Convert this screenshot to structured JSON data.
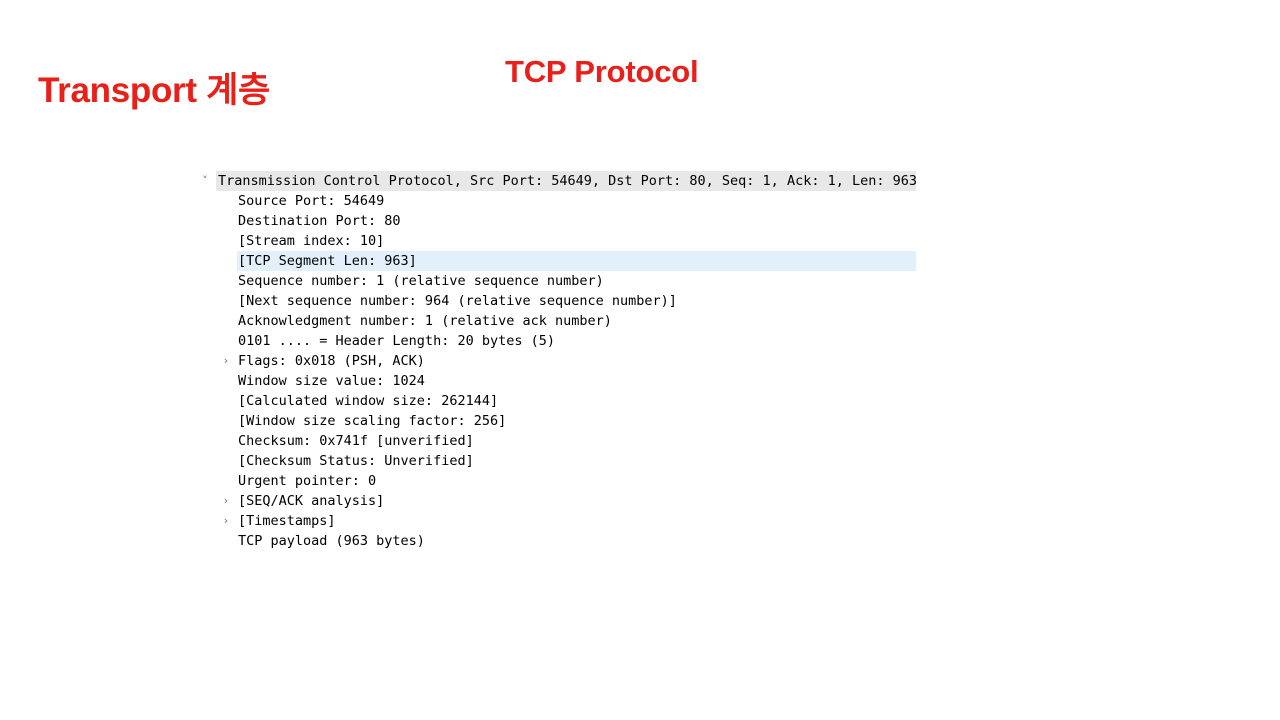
{
  "slide": {
    "title": "Transport 계층",
    "subtitle": "TCP Protocol",
    "title_color": "#e8201a"
  },
  "packet_detail": {
    "highlight_color": "#e2f0fb",
    "header_band_color": "#e8e8e8",
    "expanded_icon": "chevron-down-icon",
    "collapsed_icon": "chevron-right-icon",
    "rows": [
      {
        "label": "Transmission Control Protocol, Src Port: 54649, Dst Port: 80, Seq: 1, Ack: 1, Len: 963",
        "level": 0,
        "twisty": "expanded",
        "state": "header"
      },
      {
        "label": "Source Port: 54649",
        "level": 1,
        "twisty": "none",
        "state": "normal"
      },
      {
        "label": "Destination Port: 80",
        "level": 1,
        "twisty": "none",
        "state": "normal"
      },
      {
        "label": "[Stream index: 10]",
        "level": 1,
        "twisty": "none",
        "state": "normal"
      },
      {
        "label": "[TCP Segment Len: 963]",
        "level": 1,
        "twisty": "none",
        "state": "selected"
      },
      {
        "label": "Sequence number: 1    (relative sequence number)",
        "level": 1,
        "twisty": "none",
        "state": "normal"
      },
      {
        "label": "[Next sequence number: 964    (relative sequence number)]",
        "level": 1,
        "twisty": "none",
        "state": "normal"
      },
      {
        "label": "Acknowledgment number: 1    (relative ack number)",
        "level": 1,
        "twisty": "none",
        "state": "normal"
      },
      {
        "label": "0101 .... = Header Length: 20 bytes (5)",
        "level": 1,
        "twisty": "none",
        "state": "normal"
      },
      {
        "label": "Flags: 0x018 (PSH, ACK)",
        "level": 1,
        "twisty": "collapsed",
        "state": "normal"
      },
      {
        "label": "Window size value: 1024",
        "level": 1,
        "twisty": "none",
        "state": "normal"
      },
      {
        "label": "[Calculated window size: 262144]",
        "level": 1,
        "twisty": "none",
        "state": "normal"
      },
      {
        "label": "[Window size scaling factor: 256]",
        "level": 1,
        "twisty": "none",
        "state": "normal"
      },
      {
        "label": "Checksum: 0x741f [unverified]",
        "level": 1,
        "twisty": "none",
        "state": "normal"
      },
      {
        "label": "[Checksum Status: Unverified]",
        "level": 1,
        "twisty": "none",
        "state": "normal"
      },
      {
        "label": "Urgent pointer: 0",
        "level": 1,
        "twisty": "none",
        "state": "normal"
      },
      {
        "label": "[SEQ/ACK analysis]",
        "level": 1,
        "twisty": "collapsed",
        "state": "normal"
      },
      {
        "label": "[Timestamps]",
        "level": 1,
        "twisty": "collapsed",
        "state": "normal"
      },
      {
        "label": "TCP payload (963 bytes)",
        "level": 1,
        "twisty": "none",
        "state": "normal"
      }
    ]
  },
  "glyphs": {
    "chevron_down": "˅",
    "chevron_right": "›"
  }
}
